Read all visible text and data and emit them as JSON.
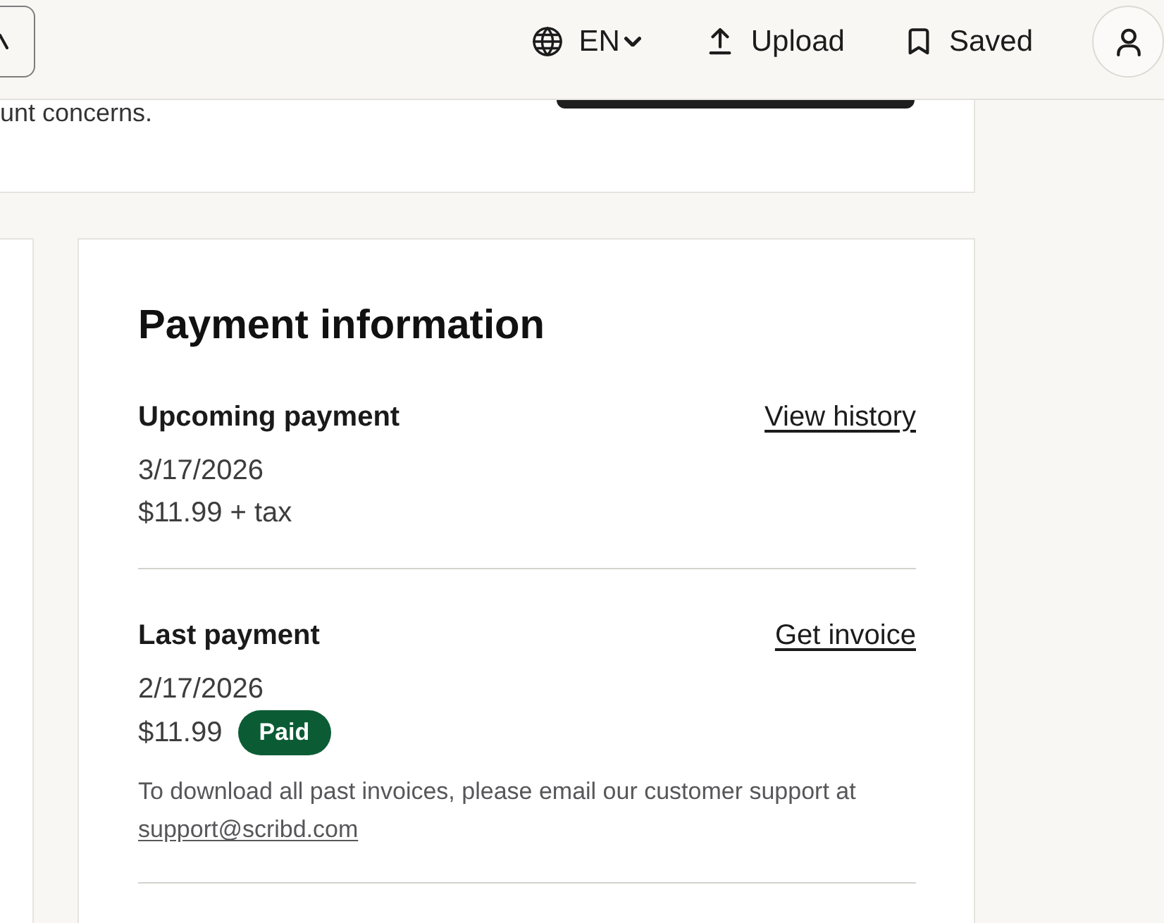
{
  "header": {
    "language": "EN",
    "upload": {
      "label": "Upload"
    },
    "saved": {
      "label": "Saved"
    }
  },
  "account_card": {
    "text": "unt concerns."
  },
  "payment_card": {
    "title": "Payment information",
    "sections": [
      {
        "heading": "Upcoming payment",
        "link": "View history",
        "date": "3/17/2026",
        "amount": "$11.99 + tax"
      },
      {
        "heading": "Last payment",
        "link": "Get invoice",
        "date": "2/17/2026",
        "amount": "$11.99",
        "status": "Paid",
        "note": "To download all past invoices, please email our customer support at",
        "email": "support@scribd.com"
      }
    ]
  }
}
